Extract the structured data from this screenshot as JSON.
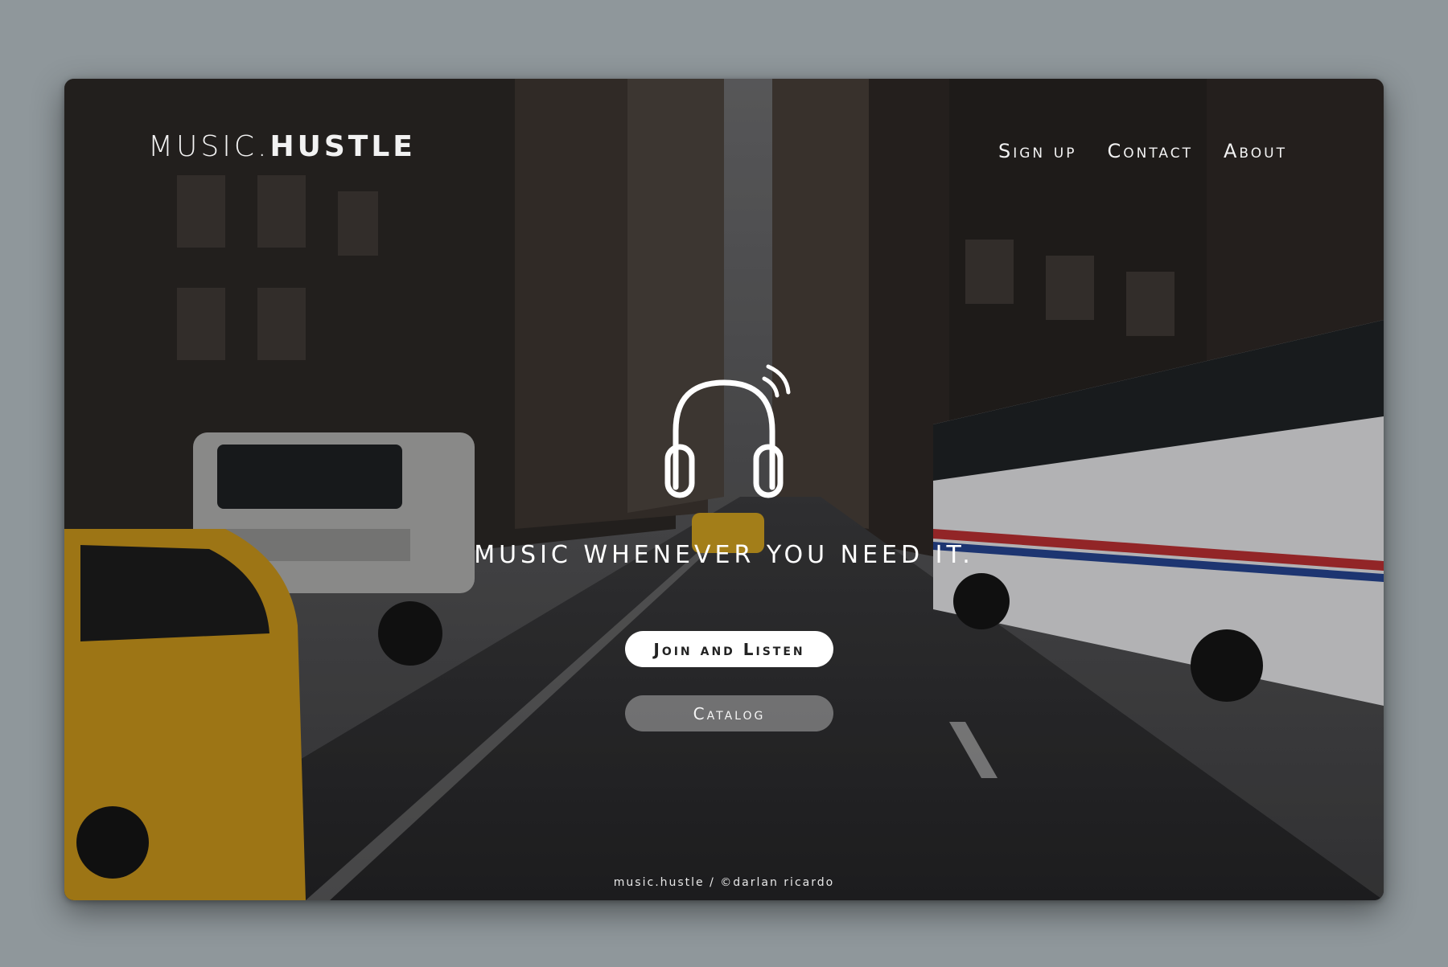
{
  "brand": {
    "logo_prefix": "MUSIC.",
    "logo_suffix": "HUSTLE"
  },
  "nav": [
    {
      "label": "Sign up"
    },
    {
      "label": "Contact"
    },
    {
      "label": "About"
    }
  ],
  "hero": {
    "icon": "headphones-icon",
    "tagline": "MUSIC WHENEVER YOU NEED IT.",
    "primary_button": "Join and Listen",
    "secondary_button": "Catalog"
  },
  "footer": {
    "text": "music.hustle / ©darlan ricardo"
  },
  "colors": {
    "page_background": "#8f979b",
    "text": "#ffffff",
    "primary_button_bg": "#ffffff",
    "secondary_button_bg": "rgba(255,255,255,0.35)"
  }
}
